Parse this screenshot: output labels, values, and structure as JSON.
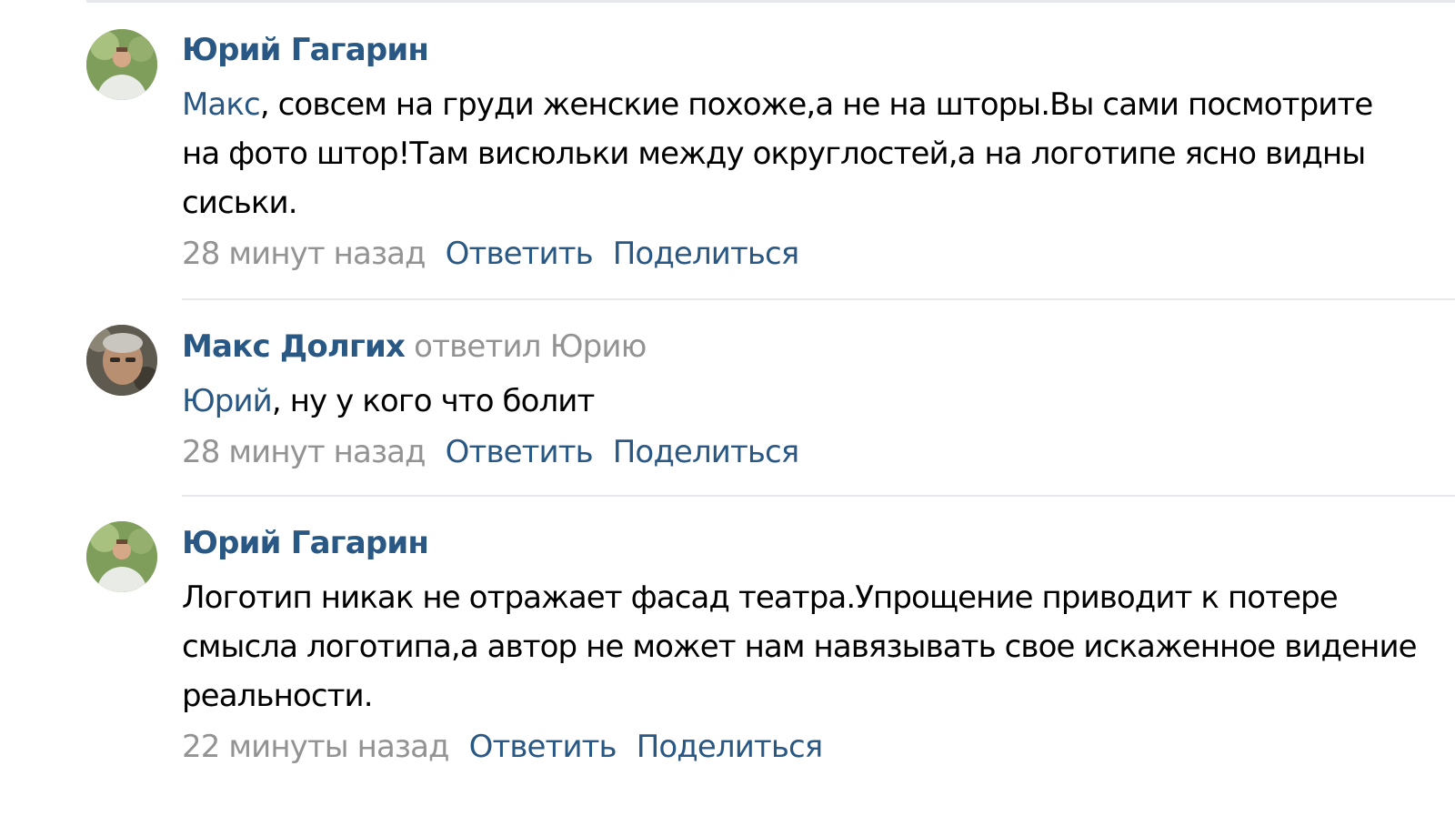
{
  "comments": [
    {
      "author": "Юрий Гагарин",
      "replied_text": "",
      "mention": "Макс",
      "text": ", совсем на груди женские похоже,а не на шторы.Вы сами посмотрите на фото штор!Там висюльки между округлостей,а на логотипе ясно видны сиськи.",
      "time": "28 минут назад",
      "reply_label": "Ответить",
      "share_label": "Поделиться"
    },
    {
      "author": "Макс Долгих",
      "replied_text": "ответил Юрию",
      "mention": "Юрий",
      "text": ", ну у кого что болит",
      "time": "28 минут назад",
      "reply_label": "Ответить",
      "share_label": "Поделиться"
    },
    {
      "author": "Юрий Гагарин",
      "replied_text": "",
      "mention": "",
      "text": "Логотип никак не отражает фасад театра.Упрощение приводит к потере смысла логотипа,а автор не может нам навязывать свое искаженное видение реальности.",
      "time": "22 минуты назад",
      "reply_label": "Ответить",
      "share_label": "Поделиться"
    }
  ],
  "colors": {
    "link": "#2a5885",
    "muted": "#939393",
    "divider": "#e7e8ec"
  }
}
